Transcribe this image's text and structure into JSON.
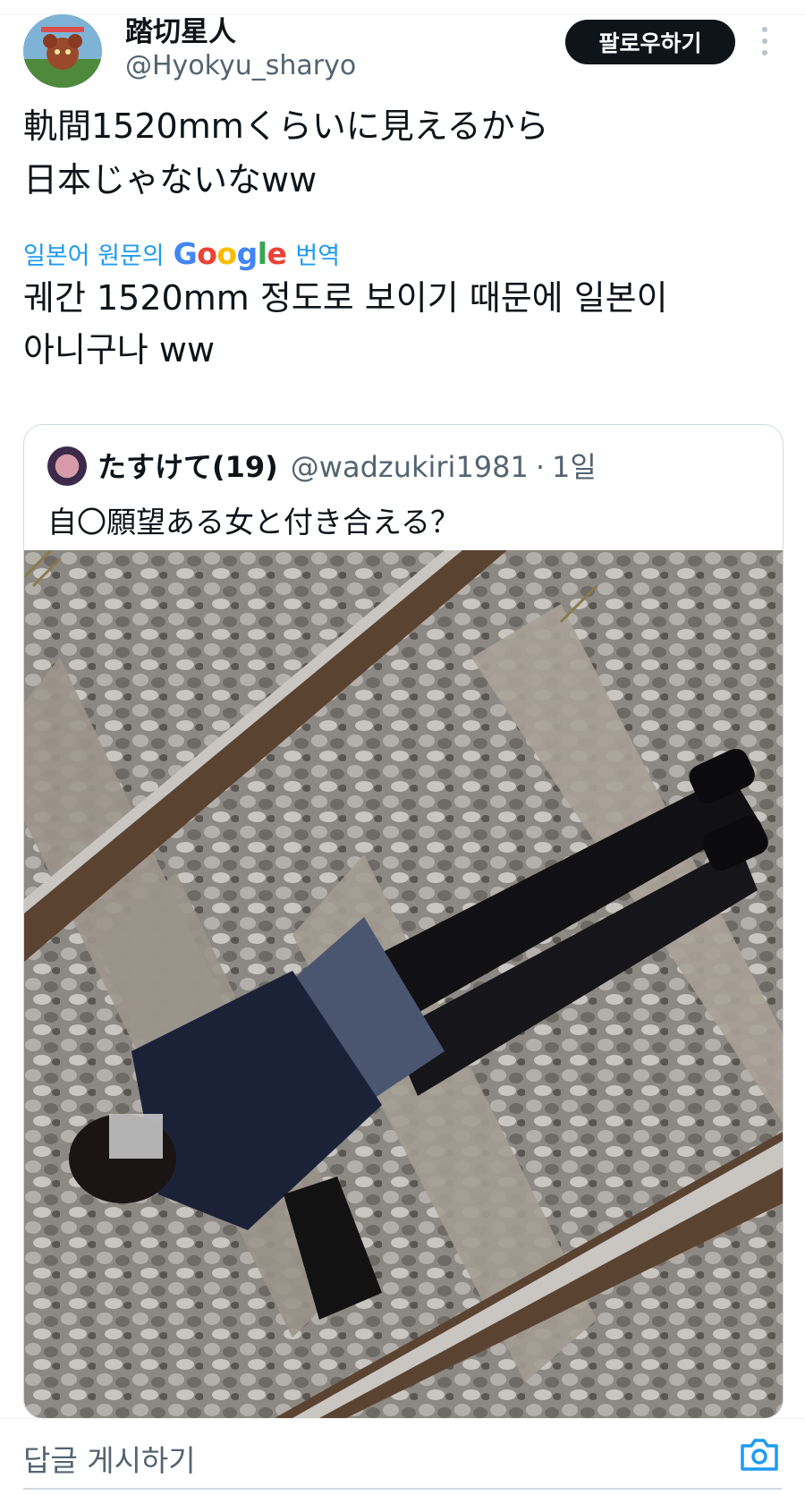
{
  "author": {
    "display_name": "踏切星人",
    "handle": "@Hyokyu_sharyo"
  },
  "follow_label": "팔로우하기",
  "tweet": {
    "original_lines": [
      "軌間1520mmくらいに見えるから",
      "日本じゃないなww"
    ],
    "translated_lines": [
      "궤간 1520mm 정도로 보이기 때문에 일본이",
      "아니구나 ww"
    ]
  },
  "translation": {
    "prefix": "일본어 원문의",
    "brand": "Google",
    "suffix": "번역"
  },
  "quoted": {
    "name": "たすけて(19)",
    "handle": "@wadzukiri1981",
    "separator": "·",
    "time": "1일",
    "text": "自〇願望ある女と付き合える？"
  },
  "reply": {
    "placeholder": "답글 게시하기"
  },
  "icons": {
    "more": "more-vertical-icon",
    "camera": "camera-icon"
  },
  "colors": {
    "link": "#1d9bf0",
    "follow_bg": "#0f1419",
    "secondary_text": "#536471"
  }
}
